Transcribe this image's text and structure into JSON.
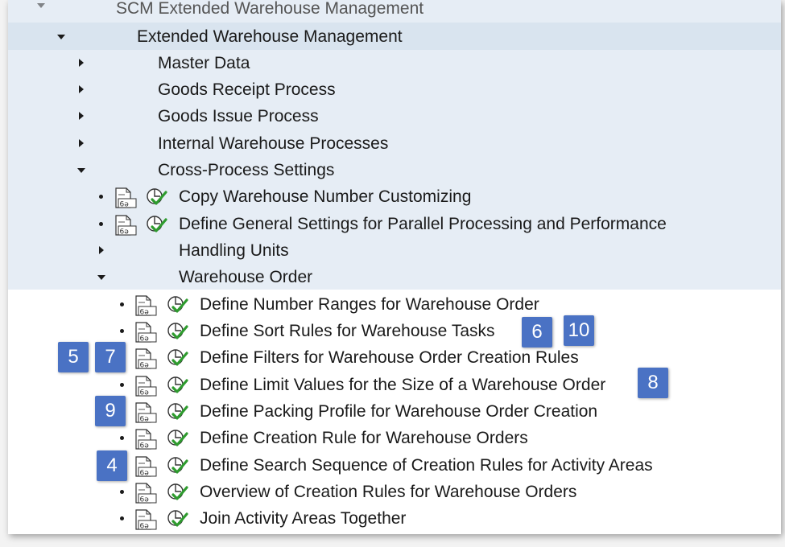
{
  "tree": {
    "root_partial": "SCM Extended Warehouse Management",
    "ewm": "Extended Warehouse Management",
    "level2": [
      "Master Data",
      "Goods Receipt Process",
      "Goods Issue Process",
      "Internal Warehouse Processes"
    ],
    "cross_process": "Cross-Process Settings",
    "cross_activities": [
      "Copy Warehouse Number Customizing",
      "Define General Settings for Parallel Processing and Performance"
    ],
    "handling_units": "Handling Units",
    "warehouse_order": "Warehouse Order",
    "wo_activities": [
      "Define Number Ranges for Warehouse Order",
      "Define Sort Rules for Warehouse Tasks",
      "Define Filters for Warehouse Order Creation Rules",
      "Define Limit Values for the Size of a Warehouse Order",
      "Define Packing Profile for Warehouse Order Creation",
      "Define Creation Rule for Warehouse Orders",
      "Define Search Sequence of Creation Rules for Activity Areas",
      "Overview of Creation Rules for Warehouse Orders",
      "Join Activity Areas Together"
    ]
  },
  "badges": {
    "b6": "6",
    "b10": "10",
    "b5": "5",
    "b7": "7",
    "b8": "8",
    "b9": "9",
    "b4": "4"
  },
  "icons": {
    "doc": "documentation-icon",
    "exec": "execute-activity-icon"
  },
  "colors": {
    "badge": "#4a72c4",
    "check": "#2e9b2e",
    "shade": "#e6edf5"
  }
}
